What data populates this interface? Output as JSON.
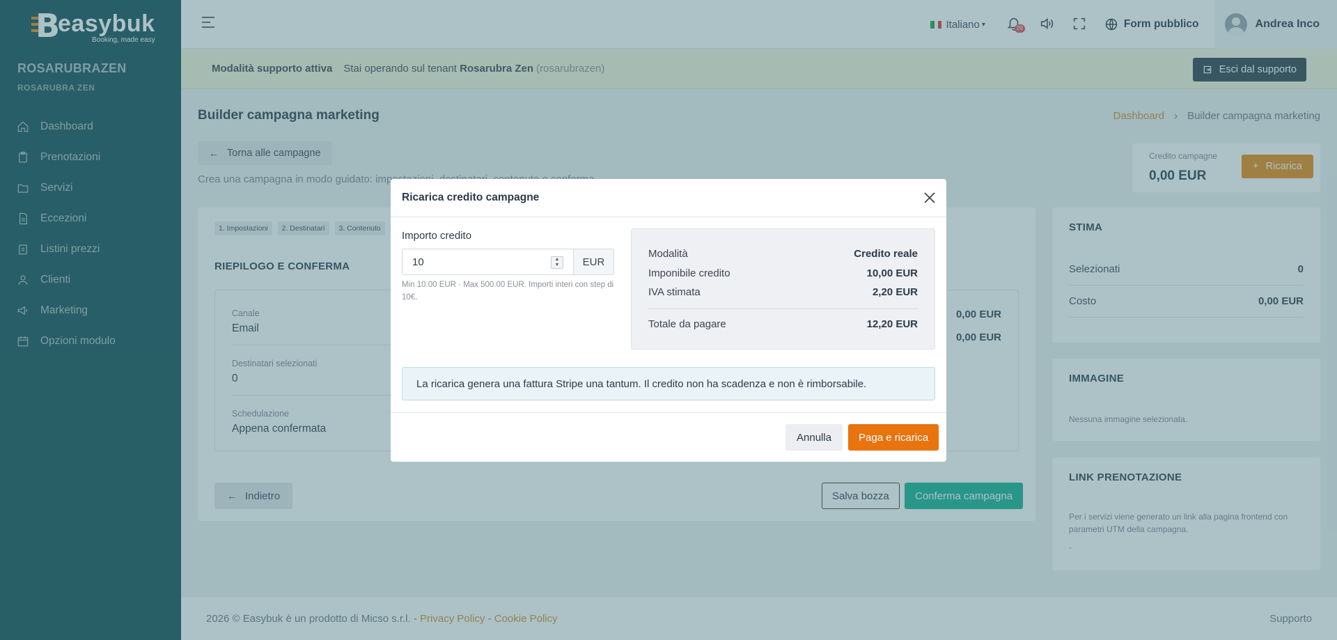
{
  "brand": {
    "name": "easybuk",
    "tagline": "Booking, made easy",
    "accent": "#e8860f",
    "sidebar_bg": "#0f4a52"
  },
  "sidebar": {
    "tenant_title": "ROSARUBRAZEN",
    "tenant_sub": "ROSARUBRA ZEN",
    "items": [
      {
        "label": "Dashboard",
        "icon": "home-icon"
      },
      {
        "label": "Prenotazioni",
        "icon": "clipboard-icon"
      },
      {
        "label": "Servizi",
        "icon": "folder-icon"
      },
      {
        "label": "Eccezioni",
        "icon": "document-icon"
      },
      {
        "label": "Listini prezzi",
        "icon": "clipboard-list-icon"
      },
      {
        "label": "Clienti",
        "icon": "user-icon"
      },
      {
        "label": "Marketing",
        "icon": "megaphone-icon"
      },
      {
        "label": "Opzioni modulo",
        "icon": "calendar-icon"
      }
    ]
  },
  "topbar": {
    "language": "Italiano",
    "notification_count": "29",
    "form_pubblico": "Form pubblico",
    "user_name": "Andrea Inco"
  },
  "support": {
    "mode_label": "Modalità supporto attiva",
    "text": "Stai operando sul tenant",
    "tenant_name": "Rosarubra Zen",
    "tenant_slug": "(rosarubrazen)",
    "exit_label": "Esci dal supporto"
  },
  "page": {
    "title": "Builder campagna marketing",
    "breadcrumb": [
      "Dashboard",
      "Builder campagna marketing"
    ],
    "back_label": "Torna alle campagne",
    "intro": "Crea una campagna in modo guidato: impostazioni, destinatari, contenuto e conferma."
  },
  "credit": {
    "label": "Credito campagne",
    "value": "0,00 EUR",
    "button": "Ricarica"
  },
  "wizard": {
    "steps": [
      "1. Impostazioni",
      "2. Destinatari",
      "3. Contenuto"
    ],
    "section_title": "RIEPILOGO E CONFERMA",
    "summary": [
      {
        "label": "Canale",
        "value": "Email"
      },
      {
        "label": "Destinatari selezionati",
        "value": "0"
      },
      {
        "label": "Schedulazione",
        "value": "Appena confermata"
      }
    ],
    "right_values": [
      "0,00 EUR",
      "0,00 EUR"
    ],
    "back_button": "Indietro",
    "save_button": "Salva bozza",
    "confirm_button": "Conferma campagna"
  },
  "stima": {
    "title": "STIMA",
    "rows": [
      {
        "label": "Selezionati",
        "value": "0"
      },
      {
        "label": "Costo",
        "value": "0,00 EUR"
      }
    ]
  },
  "immagine": {
    "title": "IMMAGINE",
    "note": "Nessuna immagine selezionata."
  },
  "link_prenotazione": {
    "title": "LINK PRENOTAZIONE",
    "note": "Per i servizi viene generato un link alla pagina frontend con parametri UTM della campagna.",
    "value": "-"
  },
  "footer": {
    "copyright": "2026 © Easybuk è un prodotto di Micso s.r.l. -",
    "privacy": "Privacy Policy",
    "dash": "-",
    "cookie": "Cookie Policy",
    "support": "Supporto"
  },
  "modal": {
    "title": "Ricarica credito campagne",
    "field_label": "Importo credito",
    "amount": "10",
    "currency": "EUR",
    "help": "Min 10.00 EUR · Max 500.00 EUR. Importi interi con step di 10€.",
    "rows": [
      {
        "label": "Modalità",
        "value": "Credito reale"
      },
      {
        "label": "Imponibile credito",
        "value": "10,00 EUR"
      },
      {
        "label": "IVA stimata",
        "value": "2,20 EUR"
      }
    ],
    "total": {
      "label": "Totale da pagare",
      "value": "12,20 EUR"
    },
    "info": "La ricarica genera una fattura Stripe una tantum. Il credito non ha scadenza e non è rimborsabile.",
    "cancel": "Annulla",
    "pay": "Paga e ricarica"
  }
}
